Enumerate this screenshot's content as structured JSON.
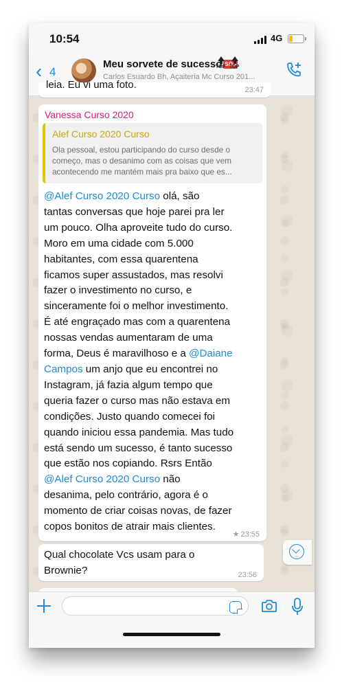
{
  "status": {
    "time": "10:54",
    "network": "4G"
  },
  "header": {
    "back_count": "4",
    "title": "Meu sorvete de sucesso",
    "sos_badge": "SOS",
    "top_badge": "TOP",
    "subtitle": "Carlos Esuardo Bh, Açaiteria Mc Curso 201..."
  },
  "messages": [
    {
      "text": "leia. Eu vi uma foto.",
      "time": "23:47"
    },
    {
      "sender": "Vanessa Curso 2020",
      "quote_author": "Alef Curso 2020  Curso",
      "quote_lines": [
        "Ola pessoal, estou participando do curso desde o",
        "começo, mas o desanimo com as coisas que vem",
        "acontecendo me mantém mais pra baixo que es..."
      ],
      "lines": [
        {
          "mention": "@Alef Curso 2020  Curso",
          "text": " olá, são"
        },
        {
          "text": "tantas conversas que hoje parei pra ler"
        },
        {
          "text": "um pouco. Olha aproveite tudo do curso."
        },
        {
          "text": "Moro em uma cidade com 5.000"
        },
        {
          "text": "habitantes, com essa quarentena"
        },
        {
          "text": "ficamos super assustados, mas resolvi"
        },
        {
          "text": "fazer o investimento no curso, e"
        },
        {
          "text": "sinceramente foi o melhor investimento."
        },
        {
          "text": "É até engraçado mas com a quarentena"
        },
        {
          "text": "nossas vendas aumentaram de uma"
        },
        {
          "text": "forma, Deus é maravilhoso e a ",
          "mention": "@Daiane"
        },
        {
          "mention": "Campos",
          "text": " um anjo que eu encontrei no"
        },
        {
          "text": "Instagram, já fazia algum tempo que"
        },
        {
          "text": "queria fazer o curso mas não estava em"
        },
        {
          "text": "condições. Justo quando comecei foi"
        },
        {
          "text": "quando iniciou essa pandemia. Mas tudo"
        },
        {
          "text": "está sendo um sucesso, é tanto sucesso"
        },
        {
          "text": "que estão nos copiando. Rsrs Então"
        },
        {
          "mention": "@Alef Curso 2020  Curso",
          "text": "  não"
        },
        {
          "text": "desanima, pelo contrário, agora é o"
        },
        {
          "text": "momento de criar coisas novas, de fazer"
        },
        {
          "text": "copos bonitos de atrair mais clientes."
        }
      ],
      "starred": true,
      "time": "23:55"
    },
    {
      "text": "Qual chocolate Vcs usam para o Brownie?",
      "time": "23:56"
    }
  ],
  "composer": {
    "placeholder": ""
  },
  "icons": [
    "chevron-left-icon",
    "call-add-icon",
    "plus-icon",
    "sticker-icon",
    "camera-icon",
    "microphone-icon",
    "scroll-down-icon",
    "star-icon"
  ],
  "colors": {
    "accent": "#1a8bd8",
    "sender": "#d21c7a",
    "quote": "#c9a800",
    "wallpaper": "#e8e1d6"
  }
}
